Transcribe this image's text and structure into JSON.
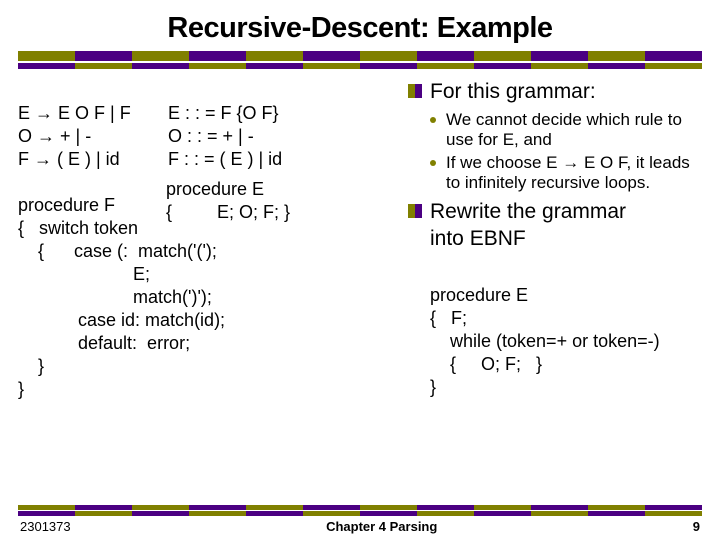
{
  "title": "Recursive-Descent: Example",
  "grammar": {
    "line1": "E → E O F | F",
    "line2": "O → + | -",
    "line3": "F → ( E ) | id"
  },
  "ebnf": {
    "line1": "E : : = F {O F}",
    "line2": "O : : = + | -",
    "line3": "F : : = ( E ) | id"
  },
  "procE": {
    "line1": "procedure E",
    "line2": "{         E; O; F; }"
  },
  "procF": {
    "line1": "procedure F",
    "line2": "{   switch token",
    "line3": "    {      case (:  match('(');",
    "line4": "                       E;",
    "line5": "                       match(')');",
    "line6": "            case id: match(id);",
    "line7": "            default:  error;",
    "line8": "    }",
    "line9": "}"
  },
  "right": {
    "bullet1": "For this grammar:",
    "sub1": "We cannot decide which rule to use for E, and",
    "sub2": "If we choose E → E O F, it leads to infinitely recursive loops.",
    "bullet2a": "Rewrite the grammar",
    "bullet2b": "into EBNF",
    "proc": {
      "l1": "procedure E",
      "l2": "{   F;",
      "l3": "    while (token=+ or token=-)",
      "l4": "    {     O; F;   }",
      "l5": "}"
    }
  },
  "footer": {
    "left": "2301373",
    "center": "Chapter 4   Parsing",
    "right": "9"
  }
}
